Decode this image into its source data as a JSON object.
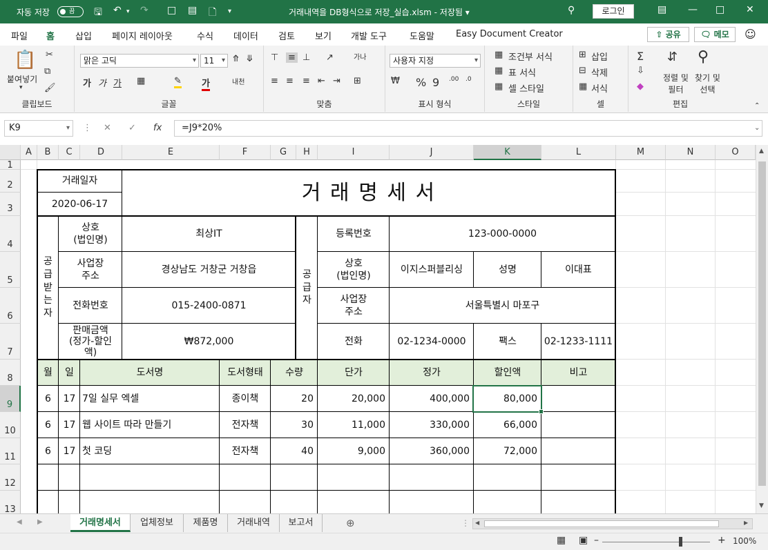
{
  "titlebar": {
    "autosave_label": "자동 저장",
    "autosave_state": "끔",
    "title": "거래내역을 DB형식으로 저장_실습.xlsm  -  저장됨 ▾",
    "login": "로그인"
  },
  "menu": {
    "tabs": [
      "파일",
      "홈",
      "삽입",
      "페이지 레이아웃",
      "수식",
      "데이터",
      "검토",
      "보기",
      "개발 도구",
      "도움말",
      "Easy Document Creator"
    ],
    "active": "홈",
    "share": "공유",
    "memo": "메모"
  },
  "ribbon": {
    "clipboard": {
      "paste": "붙여넣기",
      "label": "클립보드"
    },
    "font": {
      "name": "맑은 고딕",
      "size": "11",
      "label": "글꼴"
    },
    "align": {
      "label": "맞춤"
    },
    "number": {
      "format": "사용자 지정",
      "label": "표시 형식"
    },
    "styles": {
      "cond": "조건부 서식",
      "table": "표 서식",
      "cell": "셀 스타일",
      "label": "스타일"
    },
    "cells": {
      "insert": "삽입",
      "delete": "삭제",
      "format": "서식",
      "label": "셀"
    },
    "edit": {
      "sort": "정렬 및\n필터",
      "find": "찾기 및\n선택",
      "label": "편집"
    }
  },
  "formula": {
    "namebox": "K9",
    "fx": "fx",
    "content": "=J9*20%"
  },
  "grid": {
    "columns": [
      "A",
      "B",
      "C",
      "D",
      "E",
      "F",
      "G",
      "H",
      "I",
      "J",
      "K",
      "L",
      "M",
      "N",
      "O"
    ],
    "selected_column": "K",
    "rows": [
      "1",
      "2",
      "3",
      "4",
      "5",
      "6",
      "7",
      "8",
      "9",
      "10",
      "11",
      "12",
      "13"
    ],
    "selected_row": "9"
  },
  "doc": {
    "date_label": "거래일자",
    "date": "2020-06-17",
    "title": "거 래 명 세 서",
    "recv_label": "공\n급\n받\n는\n자",
    "recv": {
      "company_label": "상호\n(법인명)",
      "company": "최상IT",
      "addr_label": "사업장\n주소",
      "addr": "경상남도 거창군 거창읍",
      "phone_label": "전화번호",
      "phone": "015-2400-0871",
      "sales_label": "판매금액\n(정가-할인\n액)",
      "sales": "₩872,000"
    },
    "supp_label": "공\n급\n자",
    "supp": {
      "reg_label": "등록번호",
      "reg": "123-000-0000",
      "company_label": "상호\n(법인명)",
      "company": "이지스퍼블리싱",
      "name_label": "성명",
      "name": "이대표",
      "addr_label": "사업장\n주소",
      "addr": "서울특별시 마포구",
      "tel_label": "전화",
      "tel": "02-1234-0000",
      "fax_label": "팩스",
      "fax": "02-1233-1111"
    },
    "headers": [
      "월",
      "일",
      "도서명",
      "도서형태",
      "수량",
      "단가",
      "정가",
      "할인액",
      "비고"
    ],
    "items": [
      [
        "6",
        "17",
        "7일 실무 엑셀",
        "종이책",
        "20",
        "20,000",
        "400,000",
        "80,000",
        ""
      ],
      [
        "6",
        "17",
        "웹 사이트 따라 만들기",
        "전자책",
        "30",
        "11,000",
        "330,000",
        "66,000",
        ""
      ],
      [
        "6",
        "17",
        "첫 코딩",
        "전자책",
        "40",
        "9,000",
        "360,000",
        "72,000",
        ""
      ]
    ]
  },
  "sheets": {
    "tabs": [
      "거래명세서",
      "업체정보",
      "제품명",
      "거래내역",
      "보고서"
    ],
    "active": "거래명세서"
  },
  "status": {
    "zoom": "100%"
  }
}
